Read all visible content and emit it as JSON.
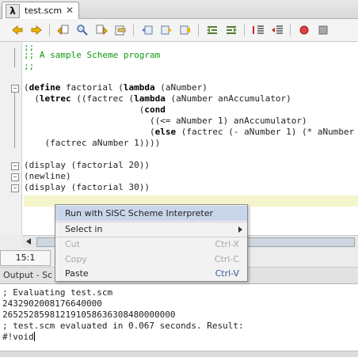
{
  "tab": {
    "icon_glyph": "λ",
    "title": "test.scm",
    "close_glyph": "✕"
  },
  "toolbar": {
    "icons": [
      "back-icon",
      "forward-icon",
      "find-previous-icon",
      "find-icon",
      "find-next-icon",
      "find-selection-icon",
      "prev-bookmark-icon",
      "next-bookmark-icon",
      "toggle-bookmark-icon",
      "shift-left-icon",
      "shift-right-icon",
      "comment-icon",
      "uncomment-icon",
      "record-macro-icon",
      "stop-macro-icon"
    ]
  },
  "editor": {
    "lines": [
      {
        "text": ";;",
        "type": "comment"
      },
      {
        "text": ";; A sample Scheme program",
        "type": "comment"
      },
      {
        "text": ";;",
        "type": "comment"
      },
      {
        "text": "",
        "type": "blank"
      },
      {
        "text": "(define factorial (lambda (aNumber)",
        "type": "code"
      },
      {
        "text": "  (letrec ((factrec (lambda (aNumber anAccumulator)",
        "type": "code"
      },
      {
        "text": "                      (cond",
        "type": "code"
      },
      {
        "text": "                        ((<= aNumber 1) anAccumulator)",
        "type": "code"
      },
      {
        "text": "                        (else (factrec (- aNumber 1) (* aNumber",
        "type": "code"
      },
      {
        "text": "    (factrec aNumber 1))))",
        "type": "code"
      },
      {
        "text": "",
        "type": "blank"
      },
      {
        "text": "(display (factorial 20))",
        "type": "code"
      },
      {
        "text": "(newline)",
        "type": "code"
      },
      {
        "text": "(display (factorial 30))",
        "type": "code"
      }
    ]
  },
  "context_menu": {
    "items": [
      {
        "label": "Run with SISC Scheme Interpreter",
        "shortcut": "",
        "enabled": true,
        "highlighted": true
      },
      {
        "label": "Select in",
        "shortcut": "",
        "enabled": true,
        "submenu": true
      },
      {
        "label": "Cut",
        "shortcut": "Ctrl-X",
        "enabled": false
      },
      {
        "label": "Copy",
        "shortcut": "Ctrl-C",
        "enabled": false
      },
      {
        "label": "Paste",
        "shortcut": "Ctrl-V",
        "enabled": true
      }
    ]
  },
  "status": {
    "position": "15:1"
  },
  "output": {
    "title": "Output - Sc",
    "lines": [
      "; Evaluating test.scm",
      "2432902008176640000",
      "265252859812191058636308480000000",
      "; test.scm evaluated in 0.067 seconds. Result:",
      "#!void"
    ]
  }
}
